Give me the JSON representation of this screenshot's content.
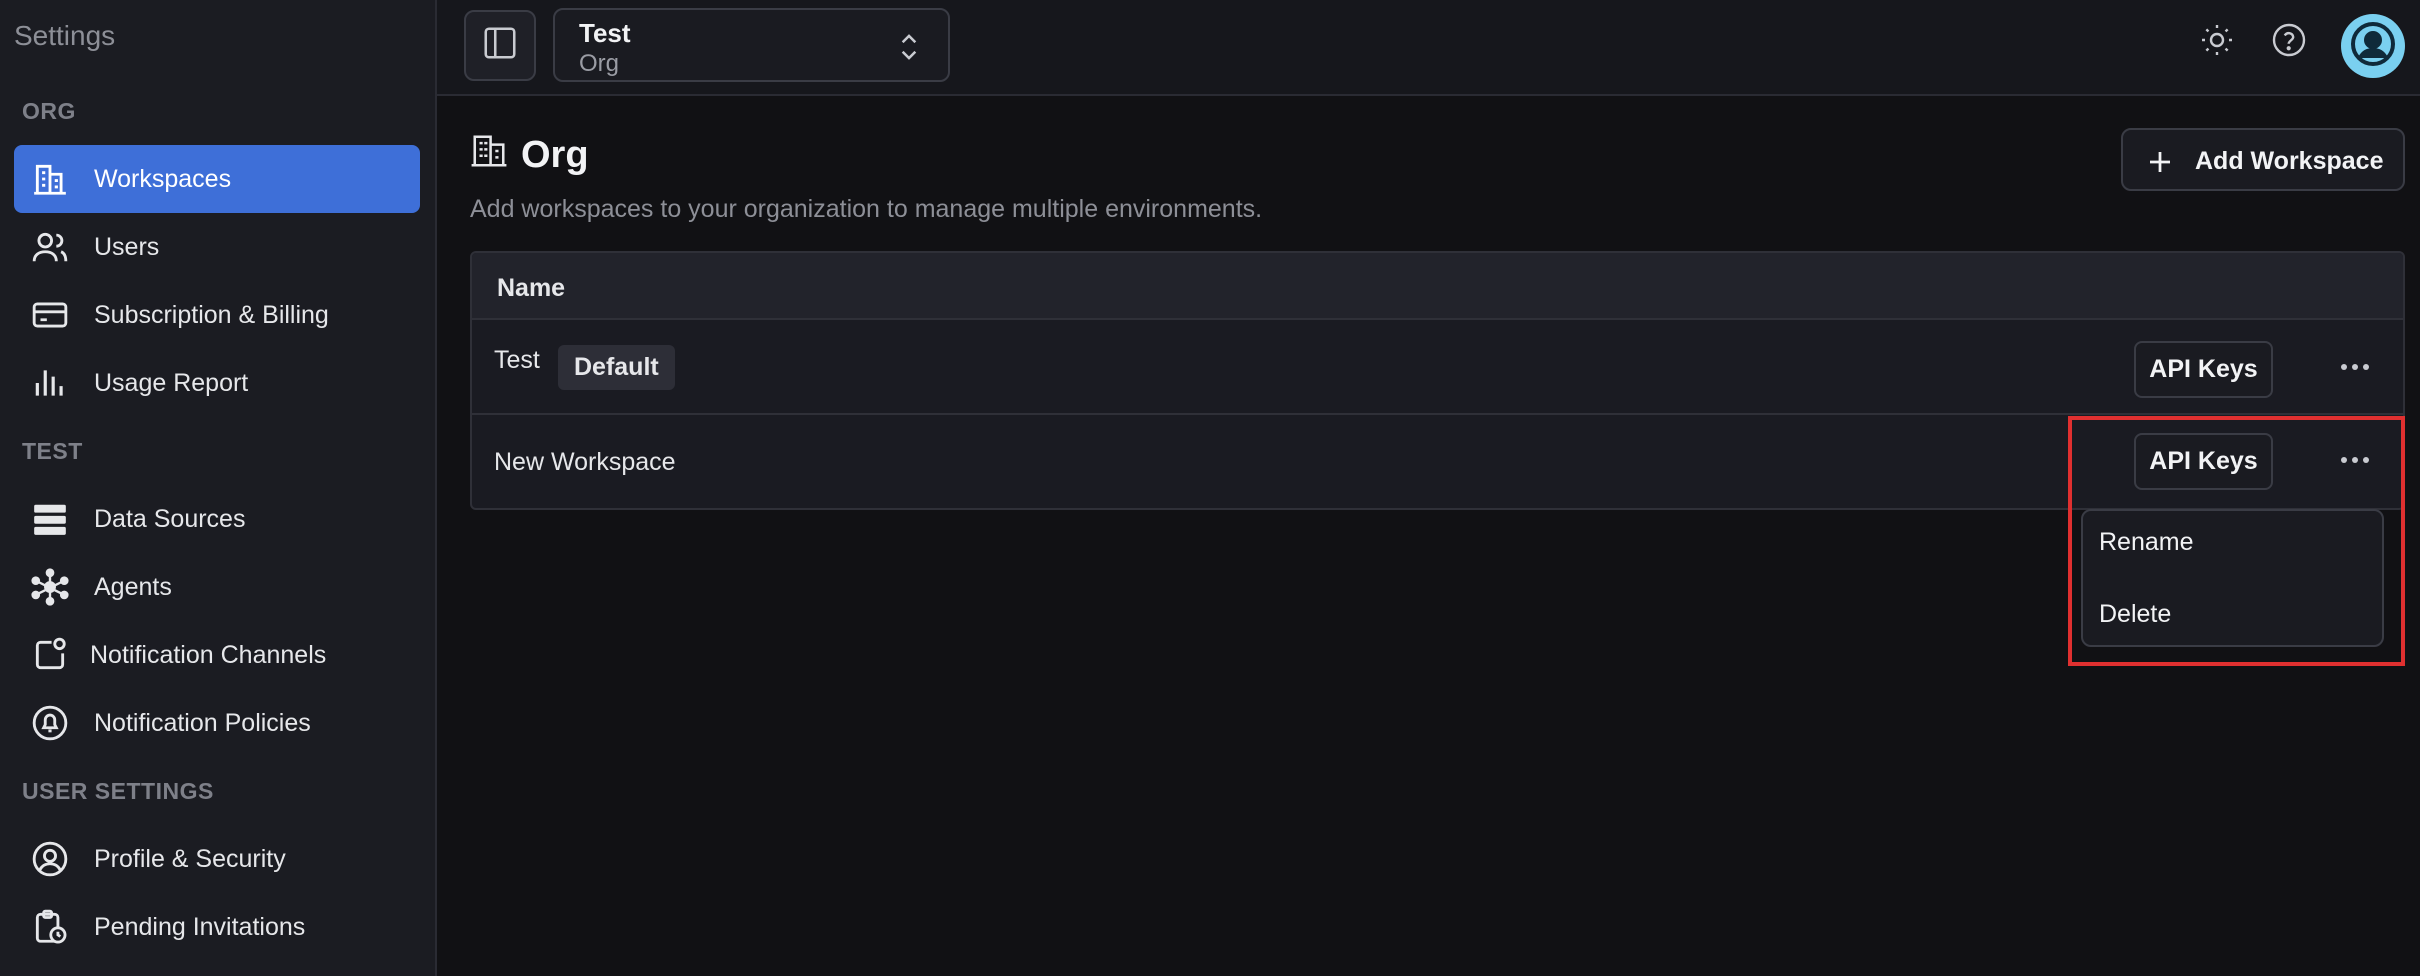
{
  "sidebar": {
    "title": "Settings",
    "sections": {
      "org": "ORG",
      "test": "TEST",
      "user": "USER SETTINGS"
    },
    "items": [
      {
        "label": "Workspaces",
        "icon": "building-icon"
      },
      {
        "label": "Users",
        "icon": "users-icon"
      },
      {
        "label": "Subscription & Billing",
        "icon": "credit-card-icon"
      },
      {
        "label": "Usage Report",
        "icon": "bar-chart-icon"
      },
      {
        "label": "Data Sources",
        "icon": "database-icon"
      },
      {
        "label": "Agents",
        "icon": "network-icon"
      },
      {
        "label": "Notification Channels",
        "icon": "notification-square-icon"
      },
      {
        "label": "Notification Policies",
        "icon": "bell-circle-icon"
      },
      {
        "label": "Profile & Security",
        "icon": "user-circle-icon"
      },
      {
        "label": "Pending Invitations",
        "icon": "clipboard-clock-icon"
      }
    ],
    "active": "Workspaces"
  },
  "topbar": {
    "workspace": "Test",
    "org": "Org"
  },
  "main": {
    "title": "Org",
    "subtitle": "Add workspaces to your organization to manage multiple environments.",
    "add_button": "Add Workspace",
    "table": {
      "columns": [
        "Name"
      ],
      "rows": [
        {
          "name": "Test",
          "badge": "Default",
          "api_keys": "API Keys"
        },
        {
          "name": "New Workspace",
          "api_keys": "API Keys"
        }
      ]
    },
    "row_menu": {
      "items": [
        "Rename",
        "Delete"
      ]
    }
  },
  "colors": {
    "accent": "#3e6fd8",
    "highlight": "#e03030",
    "avatar": "#7ad0f0"
  }
}
